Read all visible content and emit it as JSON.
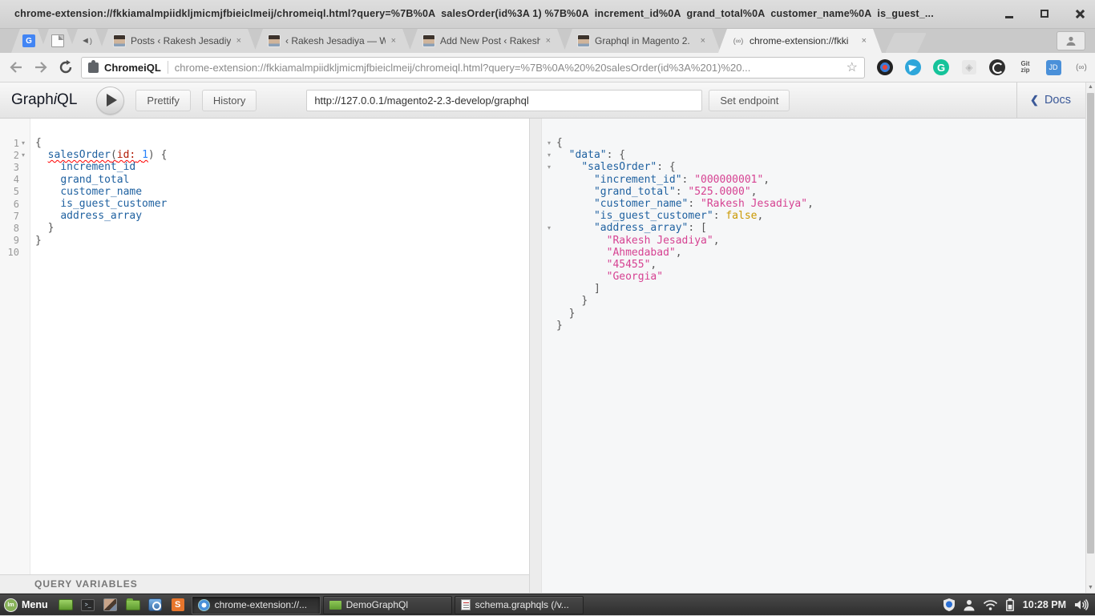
{
  "window": {
    "title": "chrome-extension://fkkiamalmpiidkljmicmjfbieiclmeij/chromeiql.html?query=%7B%0A  salesOrder(id%3A 1) %7B%0A  increment_id%0A  grand_total%0A  customer_name%0A  is_guest_..."
  },
  "browser": {
    "tabs": [
      {
        "label": "Posts ‹ Rakesh Jesadiya"
      },
      {
        "label": "‹ Rakesh Jesadiya — Wo"
      },
      {
        "label": "Add New Post ‹ Rakesh"
      },
      {
        "label": "Graphql in Magento 2."
      },
      {
        "label": "chrome-extension://fkki"
      }
    ],
    "close_glyph": "×",
    "omnibox": {
      "extension_name": "ChromeiQL",
      "url": "chrome-extension://fkkiamalmpiidkljmicmjfbieiclmeij/chromeiql.html?query=%7B%0A%20%20salesOrder(id%3A%201)%20..."
    }
  },
  "icons": {
    "star": "☆",
    "menu_dots": "⋮",
    "docs_chevron": "❮",
    "scroll_up": "▲",
    "scroll_down": "▼",
    "fold": "▾",
    "speaker_glyph": "◄))",
    "translate_letter": "G",
    "grammarly_letter": "G",
    "diamond_glyph": "◈",
    "gitzip_text": "Git zip",
    "jd_text": "JD",
    "chromeiql_glyph": "(∞)",
    "mint_text": "lm",
    "terminal_glyph": ">_",
    "sublime_letter": "S"
  },
  "graphiql": {
    "logo": {
      "part1": "Graph",
      "part2": "i",
      "part3": "QL"
    },
    "toolbar": {
      "prettify": "Prettify",
      "history": "History",
      "endpoint_value": "http://127.0.0.1/magento2-2.3-develop/graphql",
      "set_endpoint": "Set endpoint",
      "docs": "Docs"
    },
    "variables_title": "QUERY VARIABLES",
    "editor": {
      "line_count": 10,
      "fold_lines": [
        1,
        2
      ],
      "lines": [
        [
          [
            "{",
            "pn"
          ]
        ],
        [
          [
            "  ",
            ""
          ],
          [
            "salesOrder",
            "fld u"
          ],
          [
            "(",
            "pn u"
          ],
          [
            "id:",
            "arg u"
          ],
          [
            " ",
            "u"
          ],
          [
            "1",
            "num u"
          ],
          [
            ")",
            "pn"
          ],
          [
            " ",
            ""
          ],
          [
            "{",
            "pn"
          ]
        ],
        [
          [
            "    ",
            ""
          ],
          [
            "increment_id",
            "fld"
          ]
        ],
        [
          [
            "    ",
            ""
          ],
          [
            "grand_total",
            "fld"
          ]
        ],
        [
          [
            "    ",
            ""
          ],
          [
            "customer_name",
            "fld"
          ]
        ],
        [
          [
            "    ",
            ""
          ],
          [
            "is_guest_customer",
            "fld"
          ]
        ],
        [
          [
            "    ",
            ""
          ],
          [
            "address_array",
            "fld"
          ]
        ],
        [
          [
            "  ",
            ""
          ],
          [
            "}",
            "pn"
          ]
        ],
        [
          [
            "}",
            "pn"
          ]
        ],
        []
      ]
    },
    "result": {
      "fold_lines": [
        1,
        2,
        3,
        8
      ],
      "lines": [
        [
          [
            "{",
            "pn"
          ]
        ],
        [
          [
            "  ",
            ""
          ],
          [
            "\"data\"",
            "key"
          ],
          [
            ": ",
            "pn"
          ],
          [
            "{",
            "pn"
          ]
        ],
        [
          [
            "    ",
            ""
          ],
          [
            "\"salesOrder\"",
            "key"
          ],
          [
            ": ",
            "pn"
          ],
          [
            "{",
            "pn"
          ]
        ],
        [
          [
            "      ",
            ""
          ],
          [
            "\"increment_id\"",
            "key"
          ],
          [
            ": ",
            "pn"
          ],
          [
            "\"000000001\"",
            "str"
          ],
          [
            ",",
            "pn"
          ]
        ],
        [
          [
            "      ",
            ""
          ],
          [
            "\"grand_total\"",
            "key"
          ],
          [
            ": ",
            "pn"
          ],
          [
            "\"525.0000\"",
            "str"
          ],
          [
            ",",
            "pn"
          ]
        ],
        [
          [
            "      ",
            ""
          ],
          [
            "\"customer_name\"",
            "key"
          ],
          [
            ": ",
            "pn"
          ],
          [
            "\"Rakesh Jesadiya\"",
            "str"
          ],
          [
            ",",
            "pn"
          ]
        ],
        [
          [
            "      ",
            ""
          ],
          [
            "\"is_guest_customer\"",
            "key"
          ],
          [
            ": ",
            "pn"
          ],
          [
            "false",
            "bool"
          ],
          [
            ",",
            "pn"
          ]
        ],
        [
          [
            "      ",
            ""
          ],
          [
            "\"address_array\"",
            "key"
          ],
          [
            ": ",
            "pn"
          ],
          [
            "[",
            "pn"
          ]
        ],
        [
          [
            "        ",
            ""
          ],
          [
            "\"Rakesh Jesadiya\"",
            "str"
          ],
          [
            ",",
            "pn"
          ]
        ],
        [
          [
            "        ",
            ""
          ],
          [
            "\"Ahmedabad\"",
            "str"
          ],
          [
            ",",
            "pn"
          ]
        ],
        [
          [
            "        ",
            ""
          ],
          [
            "\"45455\"",
            "str"
          ],
          [
            ",",
            "pn"
          ]
        ],
        [
          [
            "        ",
            ""
          ],
          [
            "\"Georgia\"",
            "str"
          ]
        ],
        [
          [
            "      ",
            ""
          ],
          [
            "]",
            "pn"
          ]
        ],
        [
          [
            "    ",
            ""
          ],
          [
            "}",
            "pn"
          ]
        ],
        [
          [
            "  ",
            ""
          ],
          [
            "}",
            "pn"
          ]
        ],
        [
          [
            "}",
            "pn"
          ]
        ]
      ]
    }
  },
  "taskbar": {
    "menu_label": "Menu",
    "windows": [
      {
        "label": "chrome-extension://..."
      },
      {
        "label": "DemoGraphQl"
      },
      {
        "label": "schema.graphqls (/v..."
      }
    ],
    "clock": "10:28 PM"
  },
  "colors": {
    "field_blue": "#1F61A0",
    "string_pink": "#D64292",
    "bool_orange": "#CA9800",
    "number_blue": "#2882F9",
    "argument_red": "#B11A04",
    "docs_blue": "#3B5998"
  }
}
